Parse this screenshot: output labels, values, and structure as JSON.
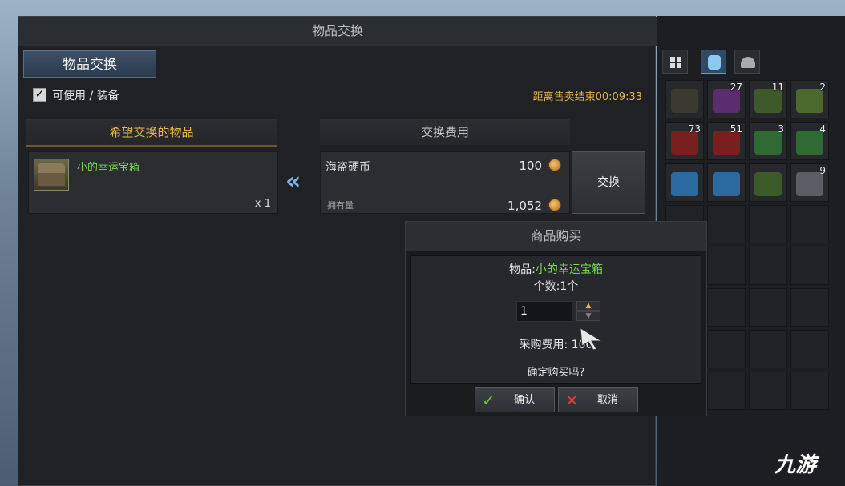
{
  "window": {
    "title": "物品交换",
    "tab_label": "物品交换",
    "filter_label": "可使用 / 装备",
    "filter_checked": true,
    "timer": "距离售卖结束00:09:33"
  },
  "exchange": {
    "wish_header": "希望交换的物品",
    "cost_header": "交换费用",
    "item_name": "小的幸运宝箱",
    "item_qty": "x 1",
    "currency_name": "海盗硬币",
    "cost": "100",
    "owned_label": "拥有量",
    "owned": "1,052",
    "exchange_button": "交换"
  },
  "inventory": {
    "slots": [
      {
        "count": "",
        "color": "#3b3a30"
      },
      {
        "count": "27",
        "color": "#5b2d6e"
      },
      {
        "count": "11",
        "color": "#3e5a2a"
      },
      {
        "count": "2",
        "color": "#4c6a2e"
      },
      {
        "count": "73",
        "color": "#7a1f1f"
      },
      {
        "count": "51",
        "color": "#7a1f1f"
      },
      {
        "count": "3",
        "color": "#2f6a34"
      },
      {
        "count": "4",
        "color": "#2f6a34"
      },
      {
        "count": "",
        "color": "#2a6aa0"
      },
      {
        "count": "",
        "color": "#2a6aa0"
      },
      {
        "count": "",
        "color": "#3c5a2a"
      },
      {
        "count": "9",
        "color": "#5a5e64"
      }
    ]
  },
  "dialog": {
    "title": "商品购买",
    "item_prefix": "物品:",
    "item_name": "小的幸运宝箱",
    "count": "个数:1个",
    "qty_value": "1",
    "cost": "采购费用: 100",
    "confirm_question": "确定购买吗?",
    "ok_label": "确认",
    "cancel_label": "取消"
  },
  "watermark": "九游"
}
